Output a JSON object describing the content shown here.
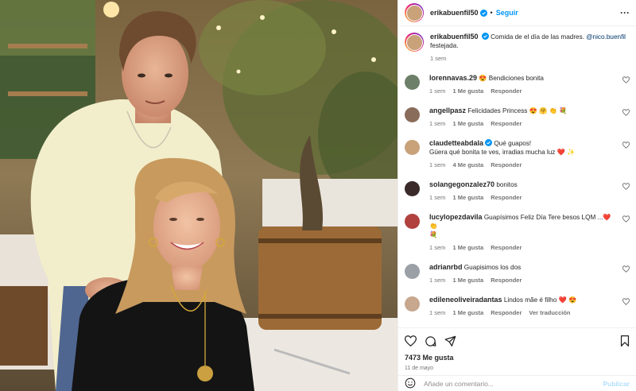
{
  "post": {
    "username": "erikabuenfil50",
    "follow_label": "Seguir",
    "caption_text": "Comida de el día de las madres. ",
    "caption_mention": "@nico.buenfil",
    "caption_tail": "festejada.",
    "caption_time": "1 sem"
  },
  "comments": [
    {
      "user": "lorennavas.29",
      "text": "😍 Bendiciones bonita",
      "time": "1 sem",
      "likes": "1 Me gusta",
      "reply": "Responder",
      "avatar_color": "#6d7f68"
    },
    {
      "user": "angellpasz",
      "text": "Felicidades Princess 😍 🤗 👏 💐",
      "time": "1 sem",
      "likes": "1 Me gusta",
      "reply": "Responder",
      "avatar_color": "#8a6c5b"
    },
    {
      "user": "claudetteabdala",
      "verified": true,
      "text": "Qué guapos!",
      "text2": "Güera qué bonita te ves, irradias mucha luz ❤️ ✨",
      "time": "1 sem",
      "likes": "4 Me gusta",
      "reply": "Responder",
      "avatar_color": "#c9a27a"
    },
    {
      "user": "solangegonzalez70",
      "text": "bonitos",
      "time": "1 sem",
      "likes": "1 Me gusta",
      "reply": "Responder",
      "avatar_color": "#3a2a2a"
    },
    {
      "user": "lucylopezdavila",
      "text": "Guapísimos Feliz Día Tere besos LQM ...❤️ 👏",
      "text2": "💐",
      "time": "1 sem",
      "likes": "1 Me gusta",
      "reply": "Responder",
      "avatar_color": "#b0413e"
    },
    {
      "user": "adrianrbd",
      "text": "Guapisimos los dos",
      "time": "1 sem",
      "likes": "1 Me gusta",
      "reply": "Responder",
      "avatar_color": "#9aa0a6"
    },
    {
      "user": "edileneoliveiradantas",
      "text": "Lindos mãe é filho ❤️ 😍",
      "time": "1 sem",
      "likes": "1 Me gusta",
      "reply": "Responder",
      "extra": "Ver traducción",
      "avatar_color": "#c7a78e"
    }
  ],
  "footer": {
    "likes": "7473 Me gusta",
    "date": "11 de mayo",
    "comment_placeholder": "Añade un comentario...",
    "publish_label": "Publicar"
  },
  "colors": {
    "accent": "#0095f6",
    "text": "#262626",
    "muted": "#737373",
    "heart": "#ed4956"
  }
}
